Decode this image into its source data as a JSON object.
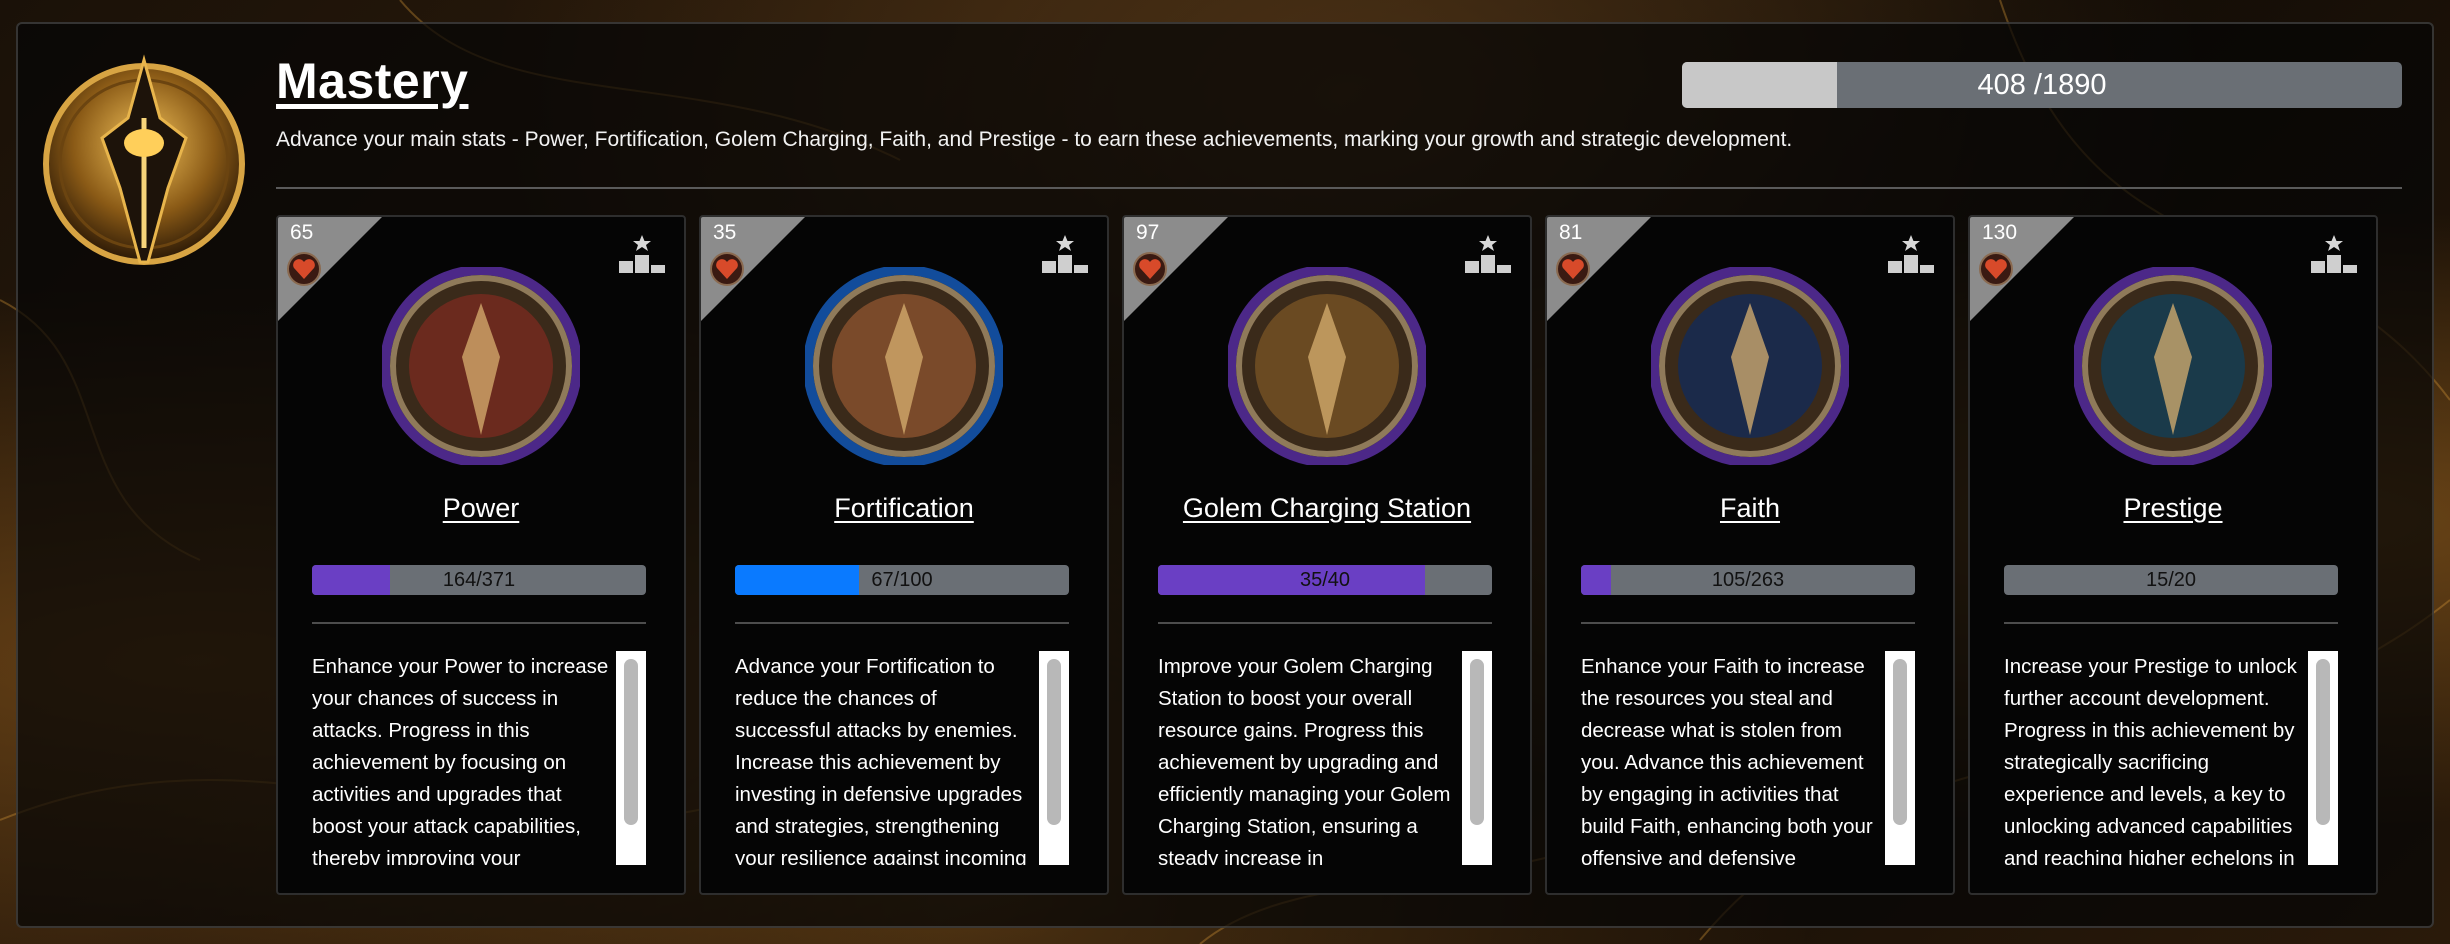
{
  "page": {
    "title": "Mastery",
    "subtitle": "Advance your main stats - Power, Fortification, Golem Charging, Faith, and Prestige - to earn these achievements, marking your growth and strategic development.",
    "total_progress": {
      "text": "408 /1890",
      "current": 408,
      "max": 1890
    }
  },
  "colors": {
    "purple": "#6a3fc4",
    "blue": "#0a7aff",
    "track": "#6a6f75",
    "corner": "#8c8c8c"
  },
  "cards": [
    {
      "level": "65",
      "name": "Power",
      "progress_text": "164/371",
      "progress": 0.2345,
      "fill_color": "#6a3fc4",
      "description": "Enhance your Power to increase your chances of success in attacks. Progress in this achievement by focusing on activities and upgrades that boost your attack capabilities, thereby improving your"
    },
    {
      "level": "35",
      "name": "Fortification",
      "progress_text": "67/100",
      "progress": 0.37,
      "fill_color": "#0a7aff",
      "description": "Advance your Fortification to reduce the chances of successful attacks by enemies. Increase this achievement by investing in defensive upgrades and strategies, strengthening your resilience against incoming"
    },
    {
      "level": "97",
      "name": "Golem Charging Station",
      "progress_text": "35/40",
      "progress": 0.8,
      "fill_color": "#6a3fc4",
      "description": "Improve your Golem Charging Station to boost your overall resource gains. Progress this achievement by upgrading and efficiently managing your Golem Charging Station, ensuring a steady increase in"
    },
    {
      "level": "81",
      "name": "Faith",
      "progress_text": "105/263",
      "progress": 0.09,
      "fill_color": "#6a3fc4",
      "description": "Enhance your Faith to increase the resources you steal and decrease what is stolen from you. Advance this achievement by engaging in activities that build Faith, enhancing both your offensive and defensive"
    },
    {
      "level": "130",
      "name": "Prestige",
      "progress_text": "15/20",
      "progress": 0,
      "fill_color": "#6a3fc4",
      "description": "Increase your Prestige to unlock further account development. Progress in this achievement by strategically sacrificing experience and levels, a key to unlocking advanced capabilities and reaching higher echelons in"
    }
  ]
}
